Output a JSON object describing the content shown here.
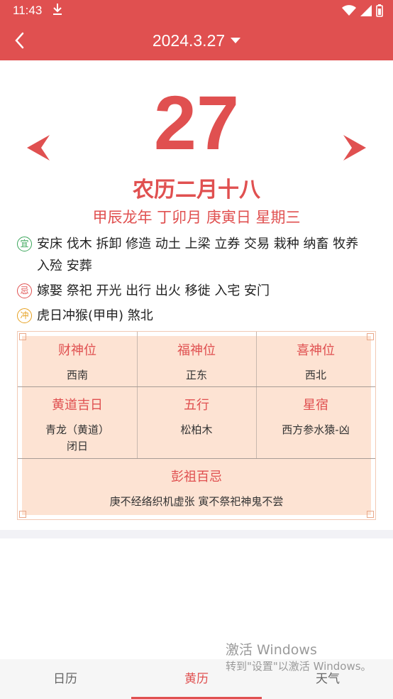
{
  "status_bar": {
    "time": "11:43",
    "download_icon": "download-icon",
    "icons": [
      "wifi-icon",
      "signal-icon",
      "battery-icon"
    ]
  },
  "app_bar": {
    "title": "2024.3.27",
    "back_icon": "chevron-left-icon",
    "dropdown_icon": "caret-down-icon"
  },
  "day": {
    "number": "27",
    "lunar": "农历二月十八",
    "ganzhi": "甲辰龙年 丁卯月 庚寅日 星期三"
  },
  "yi": {
    "badge": "宜",
    "text": "安床 伐木 拆卸 修造 动土 上梁 立券 交易 栽种 纳畜 牧养 入殓 安葬"
  },
  "ji": {
    "badge": "忌",
    "text": "嫁娶 祭祀 开光 出行 出火 移徙 入宅 安门"
  },
  "chong": {
    "badge": "冲",
    "text": "虎日冲猴(甲申) 煞北"
  },
  "table": {
    "caishen": {
      "label": "财神位",
      "value": "西南"
    },
    "fushen": {
      "label": "福神位",
      "value": "正东"
    },
    "xishen": {
      "label": "喜神位",
      "value": "西北"
    },
    "huangdao": {
      "label": "黄道吉日",
      "value_line1": "青龙（黄道）",
      "value_line2": "闭日"
    },
    "wuxing": {
      "label": "五行",
      "value": "松柏木"
    },
    "xingxiu": {
      "label": "星宿",
      "value": "西方参水猿-凶"
    },
    "pengzu": {
      "label": "彭祖百忌",
      "value": "庚不经络织机虚张 寅不祭祀神鬼不尝"
    }
  },
  "watermark": {
    "line1": "激活 Windows",
    "line2": "转到\"设置\"以激活 Windows。"
  },
  "bottom_nav": {
    "tabs": [
      "日历",
      "黄历",
      "天气"
    ],
    "active": 1
  },
  "colors": {
    "accent": "#e05050",
    "table_bg": "#fde3d3",
    "yi": "#3aa55a",
    "chong": "#e6a020"
  }
}
